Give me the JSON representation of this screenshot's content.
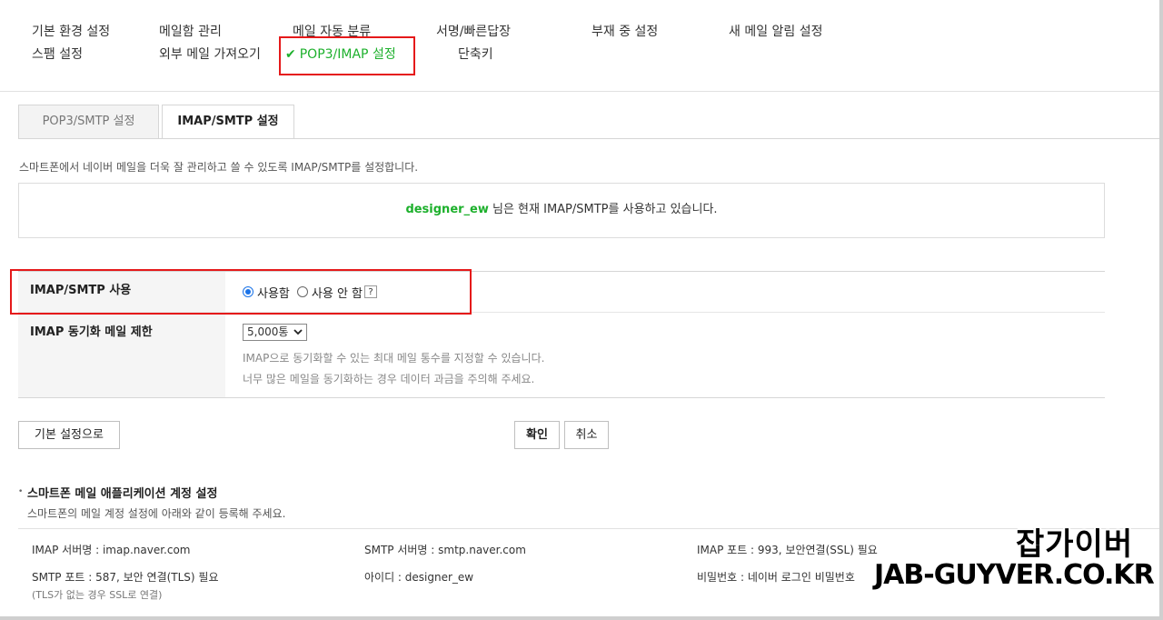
{
  "nav": {
    "row1": [
      {
        "label": "기본 환경 설정"
      },
      {
        "label": "메일함 관리"
      },
      {
        "label": "메일 자동 분류"
      },
      {
        "label": "서명/빠른답장"
      },
      {
        "label": "부재 중 설정"
      },
      {
        "label": "새 메일 알림 설정"
      }
    ],
    "row2": [
      {
        "label": "스팸 설정"
      },
      {
        "label": "외부 메일 가져오기"
      },
      {
        "label": "POP3/IMAP 설정",
        "active": true,
        "check": "✔"
      },
      {
        "label": "단축키"
      }
    ]
  },
  "tabs": [
    {
      "label": "POP3/SMTP 설정",
      "active": false
    },
    {
      "label": "IMAP/SMTP 설정",
      "active": true
    }
  ],
  "intro": "스마트폰에서 네이버 메일을 더욱 잘 관리하고 쓸 수 있도록 IMAP/SMTP를 설정합니다.",
  "status": {
    "user": "designer_ew",
    "text": " 님은 현재 IMAP/SMTP를 사용하고 있습니다."
  },
  "settings": {
    "imap_use": {
      "label": "IMAP/SMTP 사용",
      "options": [
        {
          "label": "사용함",
          "selected": true
        },
        {
          "label": "사용 안 함",
          "selected": false
        }
      ],
      "help": "?"
    },
    "sync_limit": {
      "label": "IMAP 동기화 메일 제한",
      "selected": "5,000통",
      "hint1": "IMAP으로 동기화할 수 있는 최대 메일 통수를 지정할 수 있습니다.",
      "hint2": "너무 많은 메일을 동기화하는 경우 데이터 과금을 주의해 주세요."
    }
  },
  "buttons": {
    "reset": "기본 설정으로",
    "confirm": "확인",
    "cancel": "취소"
  },
  "app_section": {
    "title": "스마트폰 메일 애플리케이션 계정 설정",
    "desc": "스마트폰의 메일 계정 설정에 아래와 같이 등록해 주세요.",
    "info": {
      "imap_server": "IMAP 서버명 : imap.naver.com",
      "smtp_server": "SMTP 서버명 : smtp.naver.com",
      "imap_port": "IMAP 포트 : 993, 보안연결(SSL) 필요",
      "smtp_port": "SMTP 포트 : 587, 보안 연결(TLS) 필요",
      "smtp_note": "(TLS가 없는 경우 SSL로 연결)",
      "user_id": "아이디 : designer_ew",
      "password": "비밀번호 : 네이버 로그인 비밀번호"
    }
  },
  "watermark": {
    "line1": "잡가이버",
    "line2": "JAB-GUYVER.CO.KR"
  },
  "colors": {
    "accent_green": "#1db02c",
    "highlight_red": "#e5191a",
    "radio_blue": "#1a73e8"
  }
}
